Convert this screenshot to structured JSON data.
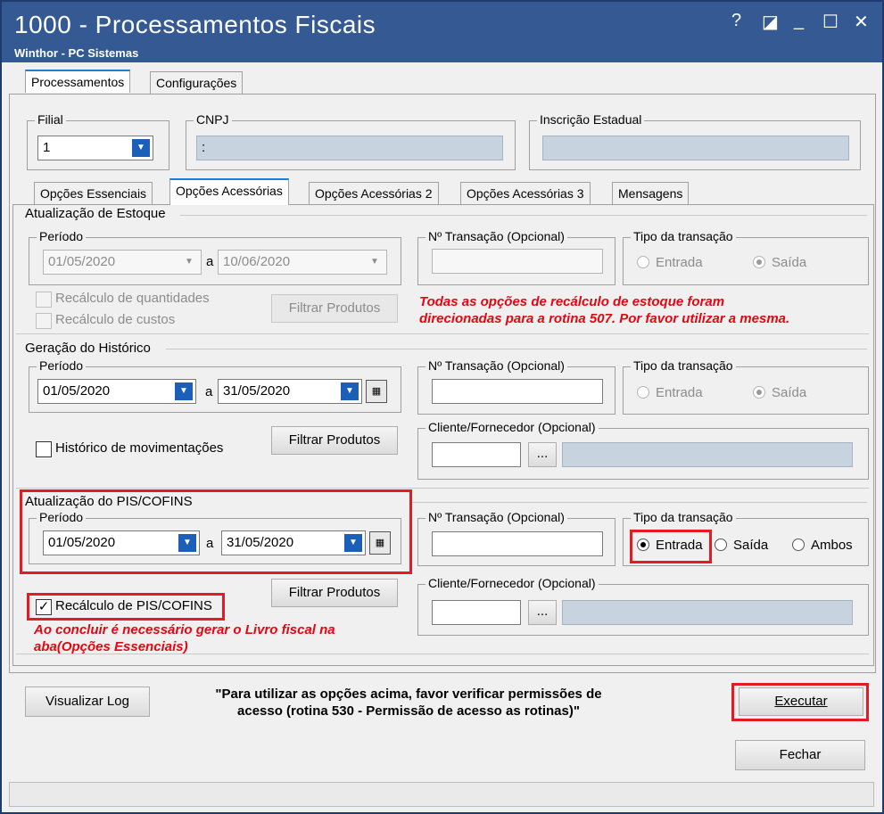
{
  "window": {
    "title": "1000 - Processamentos Fiscais",
    "subtitle": "Winthor - PC Sistemas",
    "controls": [
      "?",
      "◪",
      "_",
      "☐",
      "✕"
    ]
  },
  "top_tabs": [
    "Processamentos",
    "Configurações"
  ],
  "filial": {
    "label": "Filial",
    "value": "1"
  },
  "cnpj": {
    "label": "CNPJ",
    "value": ":"
  },
  "inscricao": {
    "label": "Inscrição Estadual",
    "value": ""
  },
  "sub_tabs": [
    "Opções Essenciais",
    "Opções Acessórias",
    "Opções Acessórias 2",
    "Opções Acessórias 3",
    "Mensagens"
  ],
  "estoque": {
    "title": "Atualização de Estoque",
    "periodo_label": "Período",
    "date_from": "01/05/2020",
    "a": "a",
    "date_to": "10/06/2020",
    "transacao_label": "Nº Transação (Opcional)",
    "tipo_label": "Tipo da transação",
    "entrada": "Entrada",
    "saida": "Saída",
    "recalc_qtd": "Recálculo de quantidades",
    "recalc_custos": "Recálculo de custos",
    "filtrar": "Filtrar Produtos",
    "note_line1": "Todas as opções de recálculo de estoque foram",
    "note_line2": "direcionadas para a rotina 507. Por favor utilizar a mesma."
  },
  "historico": {
    "title": "Geração do Histórico",
    "periodo_label": "Período",
    "date_from": "01/05/2020",
    "a": "a",
    "date_to": "31/05/2020",
    "transacao_label": "Nº Transação (Opcional)",
    "tipo_label": "Tipo da transação",
    "entrada": "Entrada",
    "saida": "Saída",
    "hist_mov": "Histórico de movimentações",
    "filtrar": "Filtrar Produtos",
    "cliente_label": "Cliente/Fornecedor (Opcional)",
    "ellipsis": "..."
  },
  "pis": {
    "title": "Atualização do PIS/COFINS",
    "periodo_label": "Período",
    "date_from": "01/05/2020",
    "a": "a",
    "date_to": "31/05/2020",
    "transacao_label": "Nº Transação (Opcional)",
    "tipo_label": "Tipo da transação",
    "entrada": "Entrada",
    "saida": "Saída",
    "ambos": "Ambos",
    "recalc": "Recálculo de PIS/COFINS",
    "recalc_check": "✓",
    "filtrar": "Filtrar Produtos",
    "cliente_label": "Cliente/Fornecedor (Opcional)",
    "ellipsis": "...",
    "note_line1": "Ao concluir é necessário gerar o Livro fiscal na",
    "note_line2": "aba(Opções Essenciais)"
  },
  "footer": {
    "log_button": "Visualizar Log",
    "message_line1": "\"Para utilizar as opções acima, favor verificar permissões de",
    "message_line2": "acesso (rotina 530 - Permissão de acesso as rotinas)\"",
    "executar": "Executar",
    "fechar": "Fechar"
  },
  "colors": {
    "title_bar": "#355a93",
    "highlight": "#e31b23",
    "note_red": "#e30613",
    "dropdown_blue": "#1c5fb8"
  }
}
